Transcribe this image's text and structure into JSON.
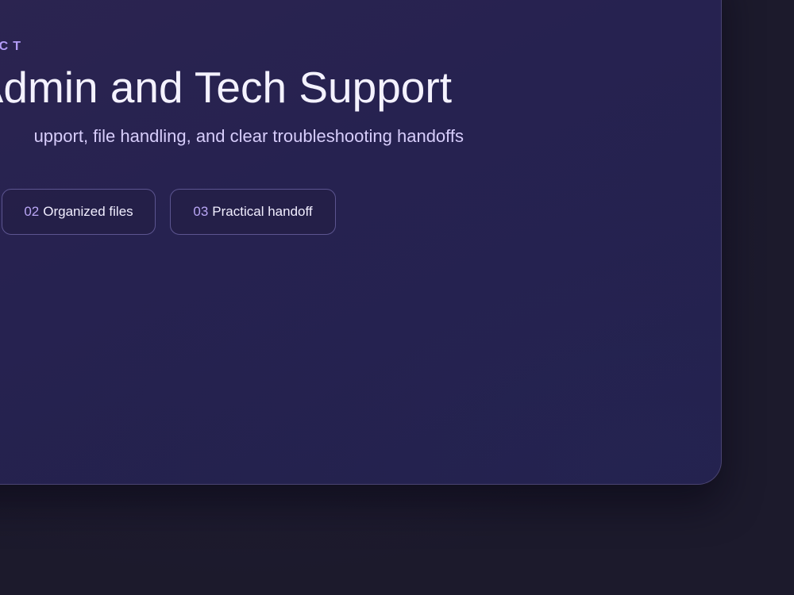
{
  "hero": {
    "eyebrow": "CT",
    "title": "Admin and Tech Support",
    "subtitle": "upport, file handling, and clear troubleshooting handoffs",
    "chips": [
      {
        "number": "02",
        "label": "Organized files"
      },
      {
        "number": "03",
        "label": "Practical handoff"
      }
    ]
  },
  "colors": {
    "page_background": "#1c1a2c",
    "card_background": "#262250",
    "accent": "#b39cf7",
    "title_text": "#f4f2ff",
    "subtitle_text": "#d7cdfb",
    "chip_border": "#5c5590"
  }
}
